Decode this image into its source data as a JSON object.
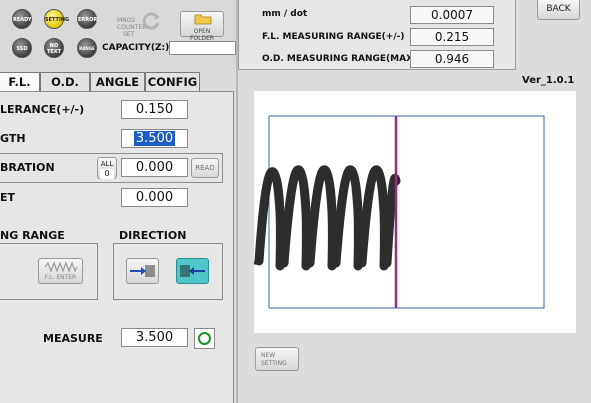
{
  "status": {
    "ready": "READY",
    "setting": "SETTING",
    "error": "ERROR",
    "ssd": "SSD",
    "no_text": [
      "NO",
      "TEXT"
    ],
    "range": "RANGE",
    "mno2_counter": [
      "MNO2",
      "COUNTER",
      "SET"
    ],
    "open_folder": "OPEN FOLDER",
    "capacity_label": "CAPACITY(Z:)",
    "capacity_value": ""
  },
  "info": {
    "mm_per_dot_label": "mm / dot",
    "mm_per_dot_value": "0.0007",
    "fl_range_label": "F.L.  MEASURING RANGE(+/-)",
    "fl_range_value": "0.215",
    "od_range_label": "O.D.  MEASURING RANGE(MAX)",
    "od_range_value": "0.946",
    "back_label": "BACK",
    "version": "Ver_1.0.1"
  },
  "tabs": [
    {
      "label": "F.L.",
      "active": true
    },
    {
      "label": "O.D.",
      "active": false
    },
    {
      "label": "ANGLE",
      "active": false
    },
    {
      "label": "CONFIG",
      "active": false
    }
  ],
  "form": {
    "tolerance_label": "LERANCE(+/-)",
    "tolerance_value": "0.150",
    "length_label": "GTH",
    "length_value": "3.500",
    "calibration_label": "BRATION",
    "all_label": "ALL",
    "all_count": "0",
    "calibration_value": "0.000",
    "read_label": "READ",
    "offset_label": "ET",
    "offset_value": "0.000",
    "range_label": "NG RANGE",
    "fl_enter_label": "F.L. ENTER",
    "direction_label": "DIRECTION",
    "measure_label": "MEASURE",
    "measure_value": "3.500",
    "new_setting": [
      "NEW",
      "SETTING"
    ]
  },
  "colors": {
    "measure_line": "#a0287f",
    "roi_box": "#3b63a8",
    "ok_indicator": "#1a8f2a",
    "direction_selected": "#4fc6c9"
  },
  "icons": {
    "refresh": "refresh-icon",
    "folder": "folder-icon",
    "arrow_right": "arrow-right-spring-icon",
    "arrow_left": "arrow-left-spring-icon",
    "spring": "spring-icon"
  }
}
